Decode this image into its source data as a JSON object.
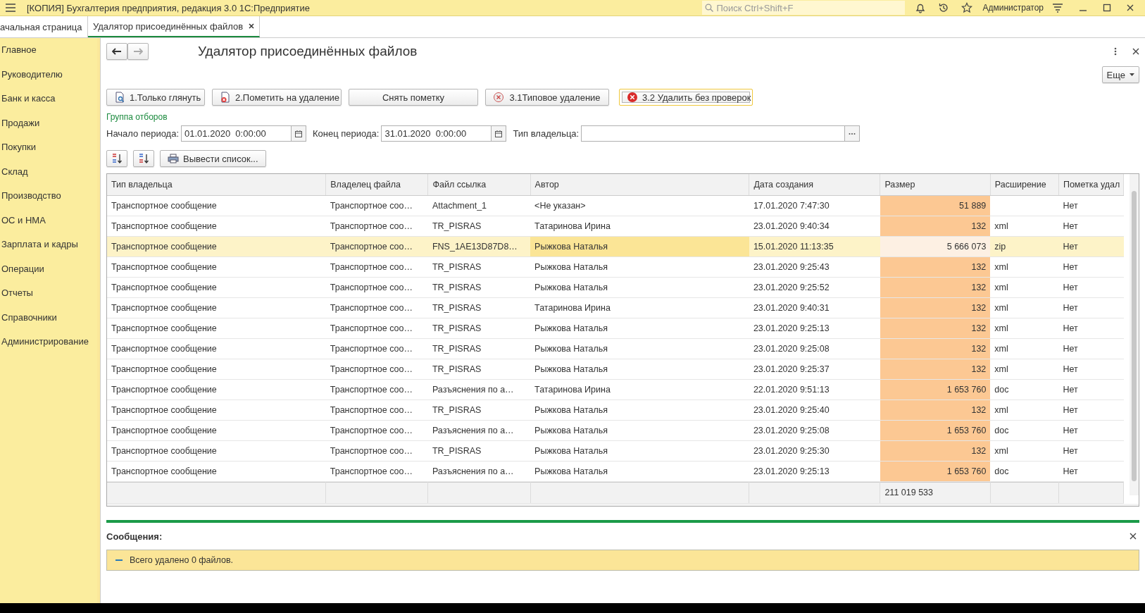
{
  "window": {
    "title": "[КОПИЯ] Бухгалтерия предприятия, редакция 3.0 1С:Предприятие",
    "search": {
      "placeholder": "Поиск Ctrl+Shift+F"
    },
    "user": "Администратор"
  },
  "tabs": [
    {
      "label": "ачальная страница",
      "selected": false
    },
    {
      "label": "Удалятор присоединённых файлов",
      "selected": true
    }
  ],
  "sidebar": {
    "items": [
      "Главное",
      "Руководителю",
      "Банк и касса",
      "Продажи",
      "Покупки",
      "Склад",
      "Производство",
      "ОС и НМА",
      "Зарплата и кадры",
      "Операции",
      "Отчеты",
      "Справочники",
      "Администрирование"
    ]
  },
  "form": {
    "title": "Удалятор присоединённых файлов",
    "more_button": "Еще",
    "buttons": [
      {
        "label": "1.Только глянуть",
        "focused": false
      },
      {
        "label": "2.Пометить на удаление",
        "focused": false
      },
      {
        "label": "Снять пометку",
        "focused": false
      },
      {
        "label": "3.1Типовое удаление",
        "focused": false
      },
      {
        "label": "3.2 Удалить без проверок",
        "focused": true
      }
    ],
    "filter_group": "Группа отборов",
    "filters": [
      {
        "label": "Начало периода:",
        "value": "01.01.2020  0:00:00",
        "kind": "date"
      },
      {
        "label": "Конец периода:",
        "value": "31.01.2020  0:00:00",
        "kind": "date"
      },
      {
        "label": "Тип владельца:",
        "kind": "choice"
      }
    ],
    "list_button": "Вывести список..."
  },
  "table": {
    "columns": [
      "Тип владельца",
      "Владелец файла",
      "Файл ссылка",
      "Автор",
      "Дата создания",
      "Размер",
      "Расширение",
      "Пометка удал"
    ],
    "rows": [
      {
        "selected": false,
        "cells": [
          "Транспортное сообщение",
          "Транспортное соо…",
          "Attachment_1",
          "<Не указан>",
          "17.01.2020 7:47:30",
          "51 889",
          "",
          "Нет"
        ]
      },
      {
        "selected": false,
        "cells": [
          "Транспортное сообщение",
          "Транспортное соо…",
          "TR_PISRAS",
          "Татаринова Ирина",
          "23.01.2020 9:40:34",
          "132",
          "xml",
          "Нет"
        ]
      },
      {
        "selected": true,
        "cells": [
          "Транспортное сообщение",
          "Транспортное соо…",
          "FNS_1AE13D87D8…",
          "Рыжкова Наталья",
          "15.01.2020 11:13:35",
          "5 666 073",
          "zip",
          "Нет"
        ]
      },
      {
        "selected": false,
        "cells": [
          "Транспортное сообщение",
          "Транспортное соо…",
          "TR_PISRAS",
          "Рыжкова Наталья",
          "23.01.2020 9:25:43",
          "132",
          "xml",
          "Нет"
        ]
      },
      {
        "selected": false,
        "cells": [
          "Транспортное сообщение",
          "Транспортное соо…",
          "TR_PISRAS",
          "Рыжкова Наталья",
          "23.01.2020 9:25:52",
          "132",
          "xml",
          "Нет"
        ]
      },
      {
        "selected": false,
        "cells": [
          "Транспортное сообщение",
          "Транспортное соо…",
          "TR_PISRAS",
          "Татаринова Ирина",
          "23.01.2020 9:40:31",
          "132",
          "xml",
          "Нет"
        ]
      },
      {
        "selected": false,
        "cells": [
          "Транспортное сообщение",
          "Транспортное соо…",
          "TR_PISRAS",
          "Рыжкова Наталья",
          "23.01.2020 9:25:13",
          "132",
          "xml",
          "Нет"
        ]
      },
      {
        "selected": false,
        "cells": [
          "Транспортное сообщение",
          "Транспортное соо…",
          "TR_PISRAS",
          "Рыжкова Наталья",
          "23.01.2020 9:25:08",
          "132",
          "xml",
          "Нет"
        ]
      },
      {
        "selected": false,
        "cells": [
          "Транспортное сообщение",
          "Транспортное соо…",
          "TR_PISRAS",
          "Рыжкова Наталья",
          "23.01.2020 9:25:37",
          "132",
          "xml",
          "Нет"
        ]
      },
      {
        "selected": false,
        "cells": [
          "Транспортное сообщение",
          "Транспортное соо…",
          "Разъяснения по а…",
          "Татаринова Ирина",
          "22.01.2020 9:51:13",
          "1 653 760",
          "doc",
          "Нет"
        ]
      },
      {
        "selected": false,
        "cells": [
          "Транспортное сообщение",
          "Транспортное соо…",
          "TR_PISRAS",
          "Рыжкова Наталья",
          "23.01.2020 9:25:40",
          "132",
          "xml",
          "Нет"
        ]
      },
      {
        "selected": false,
        "cells": [
          "Транспортное сообщение",
          "Транспортное соо…",
          "Разъяснения по а…",
          "Рыжкова Наталья",
          "23.01.2020 9:25:08",
          "1 653 760",
          "doc",
          "Нет"
        ]
      },
      {
        "selected": false,
        "cells": [
          "Транспортное сообщение",
          "Транспортное соо…",
          "TR_PISRAS",
          "Рыжкова Наталья",
          "23.01.2020 9:25:30",
          "132",
          "xml",
          "Нет"
        ]
      },
      {
        "selected": false,
        "cells": [
          "Транспортное сообщение",
          "Транспортное соо…",
          "Разъяснения по а…",
          "Рыжкова Наталья",
          "23.01.2020 9:25:13",
          "1 653 760",
          "doc",
          "Нет"
        ]
      }
    ],
    "footer": {
      "total_size": "211 019 533"
    }
  },
  "messages": {
    "title": "Сообщения:",
    "items": [
      "Всего удалено 0 файлов."
    ]
  }
}
